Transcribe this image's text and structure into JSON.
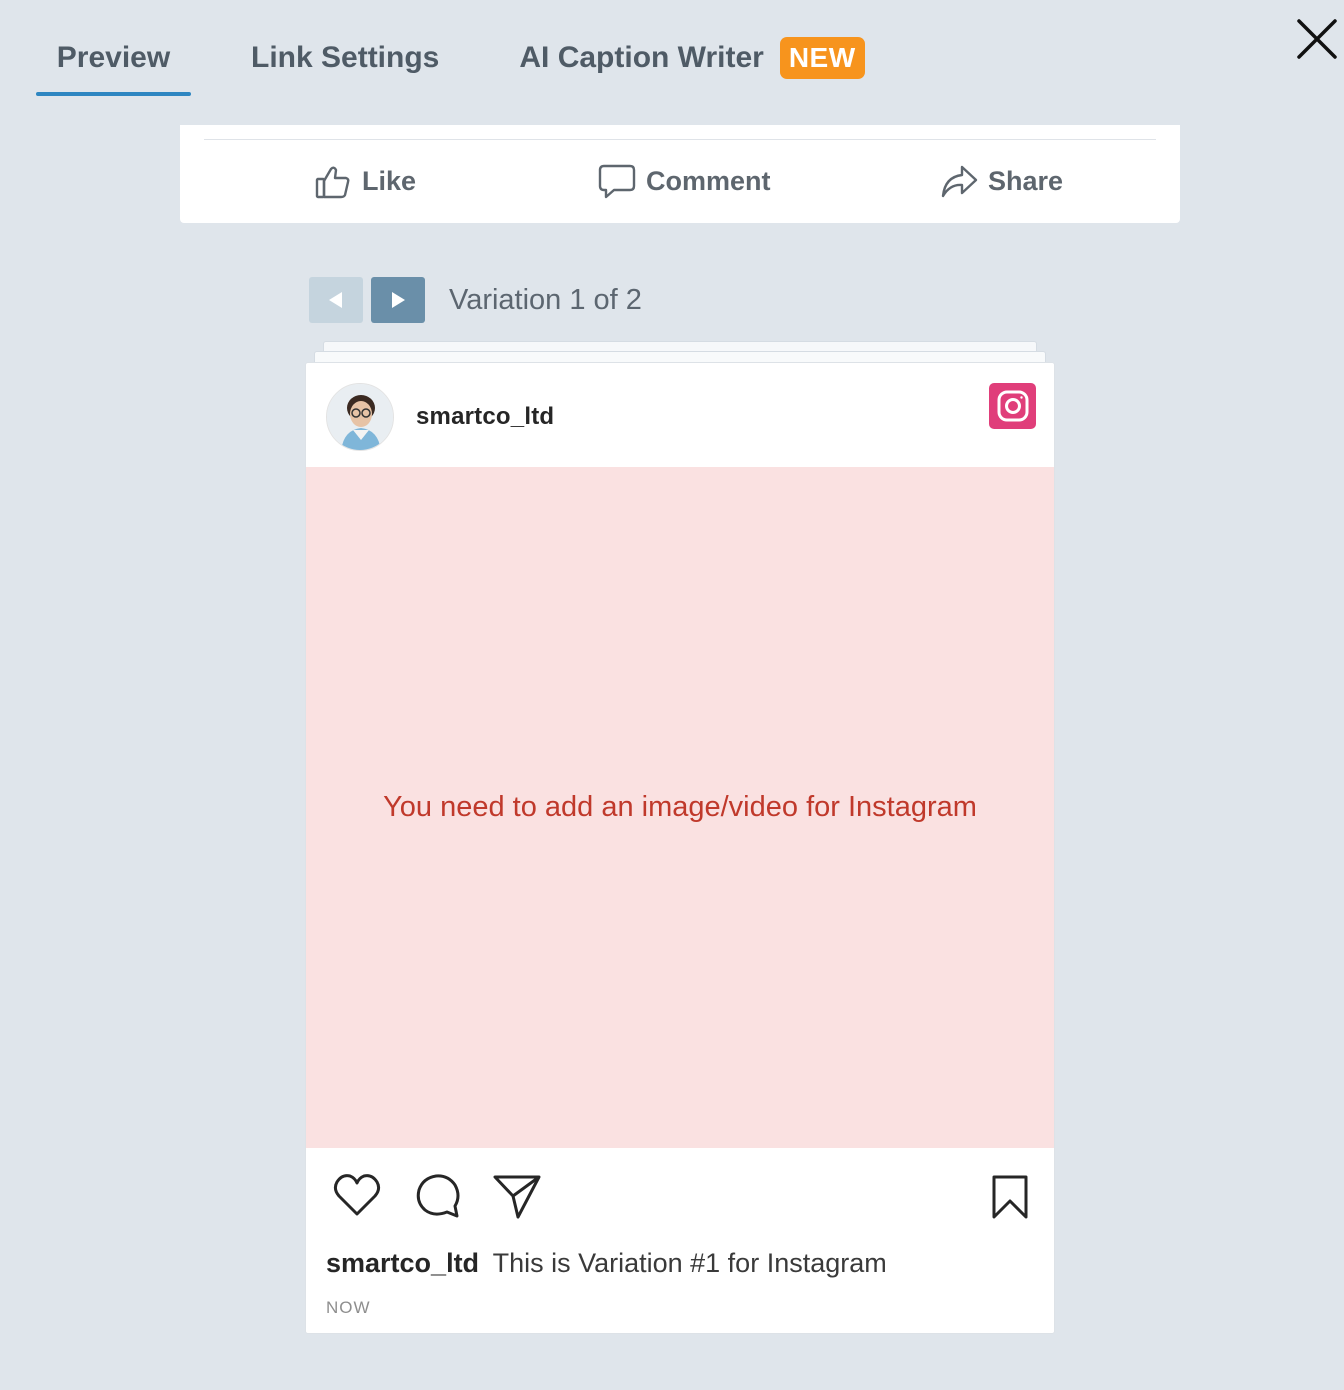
{
  "tabs": {
    "preview": "Preview",
    "link_settings": "Link Settings",
    "ai_caption": "AI Caption Writer",
    "new_badge": "NEW",
    "active": "Preview"
  },
  "facebook_actions": {
    "like": "Like",
    "comment": "Comment",
    "share": "Share"
  },
  "variation_nav": {
    "label": "Variation 1 of 2",
    "current": 1,
    "total": 2
  },
  "instagram_post": {
    "username": "smartco_ltd",
    "media_message": "You need to add an image/video for Instagram",
    "caption_user": "smartco_ltd",
    "caption_text": "This is Variation #1 for Instagram",
    "timestamp": "NOW"
  },
  "colors": {
    "background": "#dfe5eb",
    "active_tab_underline": "#2e86c1",
    "new_badge": "#f7941d",
    "instagram_logo": "#e03e7a",
    "media_placeholder_bg": "#fae1e1",
    "media_placeholder_text": "#c0392b",
    "nav_prev_disabled": "#c5d4de",
    "nav_next": "#6a8fa9"
  },
  "icons": {
    "close": "close-icon",
    "like": "thumbs-up-icon",
    "comment": "speech-bubble-icon",
    "share": "share-arrow-icon",
    "prev": "triangle-left-icon",
    "next": "triangle-right-icon",
    "instagram": "instagram-logo-icon",
    "heart": "heart-icon",
    "ig_comment": "comment-bubble-icon",
    "send": "paper-plane-icon",
    "bookmark": "bookmark-icon"
  }
}
